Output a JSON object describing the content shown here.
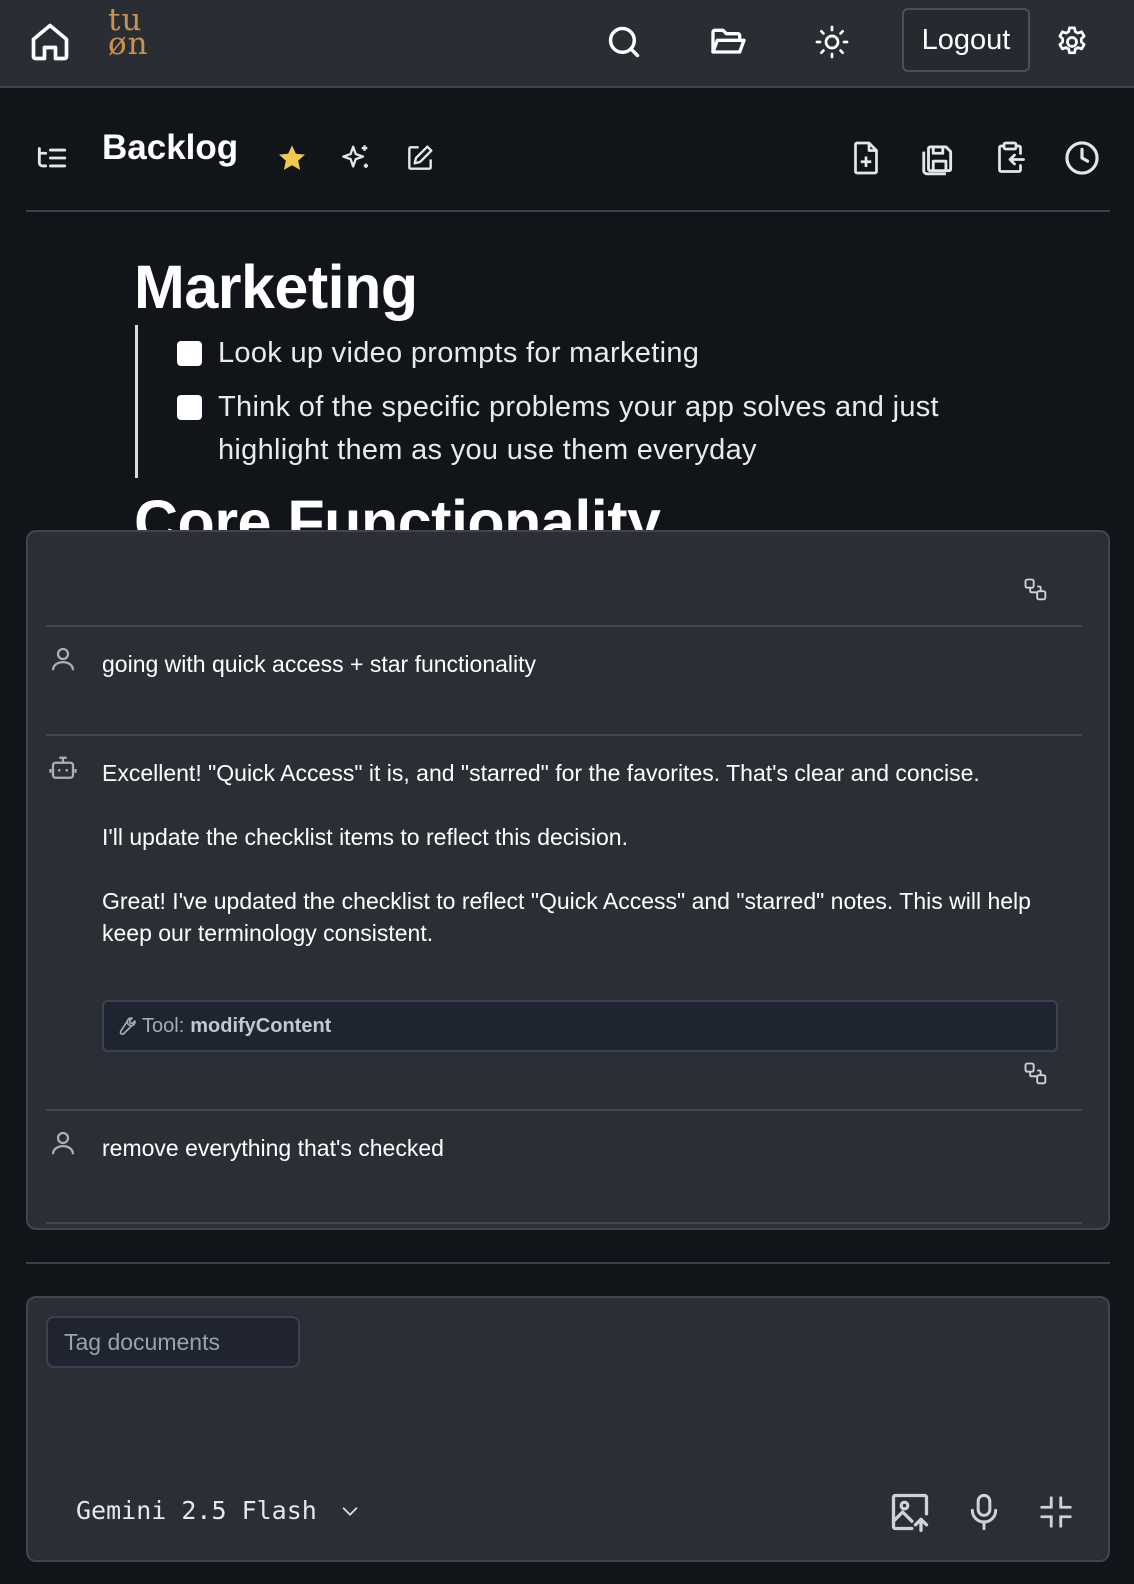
{
  "topbar": {
    "logo_line1": "tu",
    "logo_line2": "øn",
    "logout_label": "Logout"
  },
  "document": {
    "title": "Backlog",
    "starred": true
  },
  "editor": {
    "heading": "Marketing",
    "tasks": [
      {
        "text": "Look up video prompts for marketing",
        "checked": false
      },
      {
        "text": "Think of the specific problems your app solves and just highlight them as you use them everyday",
        "checked": false
      }
    ],
    "next_heading": "Core Functionality"
  },
  "chat": {
    "messages": [
      {
        "role": "user",
        "text": "going with quick access + star functionality"
      },
      {
        "role": "assistant",
        "paragraphs": [
          "Excellent! \"Quick Access\" it is, and \"starred\" for the favorites. That's clear and concise.",
          "I'll update the checklist items to reflect this decision.",
          "Great! I've updated the checklist to reflect \"Quick Access\" and \"starred\" notes. This will help keep our terminology consistent."
        ],
        "tool_prefix": "Tool:",
        "tool_name": "modifyContent"
      },
      {
        "role": "user",
        "text": "remove everything that's checked"
      }
    ]
  },
  "composer": {
    "tag_placeholder": "Tag documents",
    "model": "Gemini 2.5 Flash"
  },
  "colors": {
    "accent_star": "#f2c94c",
    "logo": "#c8924f",
    "background": "#11151a",
    "panel": "#2b2f35"
  },
  "icons": [
    "home-icon",
    "search-icon",
    "folder-open-icon",
    "sun-icon",
    "gear-icon",
    "outline-icon",
    "star-icon",
    "sparkles-icon",
    "edit-icon",
    "new-file-icon",
    "save-icon",
    "clipboard-import-icon",
    "history-icon",
    "copy-icon",
    "user-icon",
    "bot-icon",
    "wrench-icon",
    "image-upload-icon",
    "microphone-icon",
    "minimize-icon",
    "chevron-down-icon"
  ]
}
